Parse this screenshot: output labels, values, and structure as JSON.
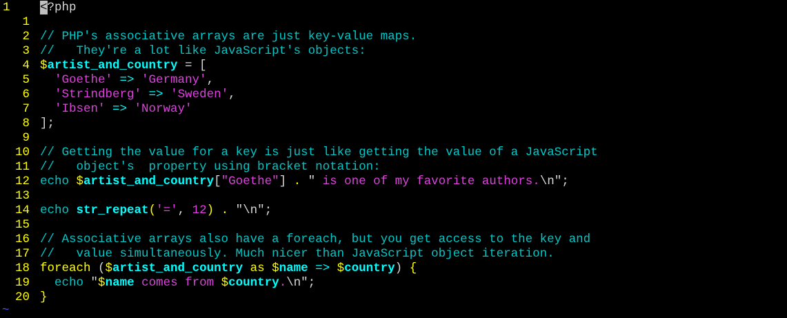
{
  "editor": {
    "empty_marker": "~",
    "lines": [
      {
        "num": "1",
        "current": true,
        "tokens": [
          {
            "t": "<",
            "c": "cursor"
          },
          {
            "t": "?php",
            "c": "plain"
          }
        ]
      },
      {
        "num": "1",
        "tokens": []
      },
      {
        "num": "2",
        "tokens": [
          {
            "t": "// PHP's associative arrays are just key-value maps.",
            "c": "comment"
          }
        ]
      },
      {
        "num": "3",
        "tokens": [
          {
            "t": "//   They're a lot like JavaScript's objects:",
            "c": "comment"
          }
        ]
      },
      {
        "num": "4",
        "tokens": [
          {
            "t": "$",
            "c": "dollar"
          },
          {
            "t": "artist_and_country",
            "c": "var"
          },
          {
            "t": " = [",
            "c": "plain"
          }
        ]
      },
      {
        "num": "5",
        "tokens": [
          {
            "t": "  ",
            "c": "plain"
          },
          {
            "t": "'Goethe'",
            "c": "string"
          },
          {
            "t": " => ",
            "c": "op"
          },
          {
            "t": "'Germany'",
            "c": "string"
          },
          {
            "t": ",",
            "c": "plain"
          }
        ]
      },
      {
        "num": "6",
        "tokens": [
          {
            "t": "  ",
            "c": "plain"
          },
          {
            "t": "'Strindberg'",
            "c": "string"
          },
          {
            "t": " => ",
            "c": "op"
          },
          {
            "t": "'Sweden'",
            "c": "string"
          },
          {
            "t": ",",
            "c": "plain"
          }
        ]
      },
      {
        "num": "7",
        "tokens": [
          {
            "t": "  ",
            "c": "plain"
          },
          {
            "t": "'Ibsen'",
            "c": "string"
          },
          {
            "t": " => ",
            "c": "op"
          },
          {
            "t": "'Norway'",
            "c": "string"
          }
        ]
      },
      {
        "num": "8",
        "tokens": [
          {
            "t": "];",
            "c": "plain"
          }
        ]
      },
      {
        "num": "9",
        "tokens": []
      },
      {
        "num": "10",
        "tokens": [
          {
            "t": "// Getting the value for a key is just like getting the value of a JavaScript",
            "c": "comment"
          }
        ]
      },
      {
        "num": "11",
        "tokens": [
          {
            "t": "//   object's  property using bracket notation:",
            "c": "comment"
          }
        ]
      },
      {
        "num": "12",
        "tokens": [
          {
            "t": "echo",
            "c": "echo"
          },
          {
            "t": " ",
            "c": "plain"
          },
          {
            "t": "$",
            "c": "dollar"
          },
          {
            "t": "artist_and_country",
            "c": "var"
          },
          {
            "t": "[",
            "c": "plain"
          },
          {
            "t": "\"Goethe\"",
            "c": "string"
          },
          {
            "t": "] ",
            "c": "plain"
          },
          {
            "t": ".",
            "c": "punct"
          },
          {
            "t": " \"",
            "c": "plain"
          },
          {
            "t": " is one of my favorite authors.",
            "c": "string"
          },
          {
            "t": "\\n\";",
            "c": "escape"
          }
        ]
      },
      {
        "num": "13",
        "tokens": []
      },
      {
        "num": "14",
        "tokens": [
          {
            "t": "echo",
            "c": "echo"
          },
          {
            "t": " ",
            "c": "plain"
          },
          {
            "t": "str_repeat",
            "c": "func"
          },
          {
            "t": "(",
            "c": "punct"
          },
          {
            "t": "'='",
            "c": "string"
          },
          {
            "t": ", ",
            "c": "plain"
          },
          {
            "t": "12",
            "c": "num"
          },
          {
            "t": ")",
            "c": "punct"
          },
          {
            "t": " ",
            "c": "plain"
          },
          {
            "t": ".",
            "c": "punct"
          },
          {
            "t": " \"\\n\";",
            "c": "plain"
          }
        ]
      },
      {
        "num": "15",
        "tokens": []
      },
      {
        "num": "16",
        "tokens": [
          {
            "t": "// Associative arrays also have a foreach, but you get access to the key and",
            "c": "comment"
          }
        ]
      },
      {
        "num": "17",
        "tokens": [
          {
            "t": "//   value simultaneously. Much nicer than JavaScript object iteration.",
            "c": "comment"
          }
        ]
      },
      {
        "num": "18",
        "tokens": [
          {
            "t": "foreach",
            "c": "kw"
          },
          {
            "t": " (",
            "c": "plain"
          },
          {
            "t": "$",
            "c": "dollar"
          },
          {
            "t": "artist_and_country",
            "c": "var"
          },
          {
            "t": " as ",
            "c": "kw"
          },
          {
            "t": "$",
            "c": "dollar"
          },
          {
            "t": "name",
            "c": "var"
          },
          {
            "t": " => ",
            "c": "op"
          },
          {
            "t": "$",
            "c": "dollar"
          },
          {
            "t": "country",
            "c": "var"
          },
          {
            "t": ") ",
            "c": "plain"
          },
          {
            "t": "{",
            "c": "punct"
          }
        ]
      },
      {
        "num": "19",
        "tokens": [
          {
            "t": "  ",
            "c": "plain"
          },
          {
            "t": "echo",
            "c": "echo"
          },
          {
            "t": " \"",
            "c": "plain"
          },
          {
            "t": "$",
            "c": "dollar"
          },
          {
            "t": "name",
            "c": "var"
          },
          {
            "t": " comes from ",
            "c": "string"
          },
          {
            "t": "$",
            "c": "dollar"
          },
          {
            "t": "country",
            "c": "var"
          },
          {
            "t": ".",
            "c": "string"
          },
          {
            "t": "\\n\";",
            "c": "escape"
          }
        ]
      },
      {
        "num": "20",
        "tokens": [
          {
            "t": "}",
            "c": "punct"
          }
        ]
      }
    ]
  }
}
